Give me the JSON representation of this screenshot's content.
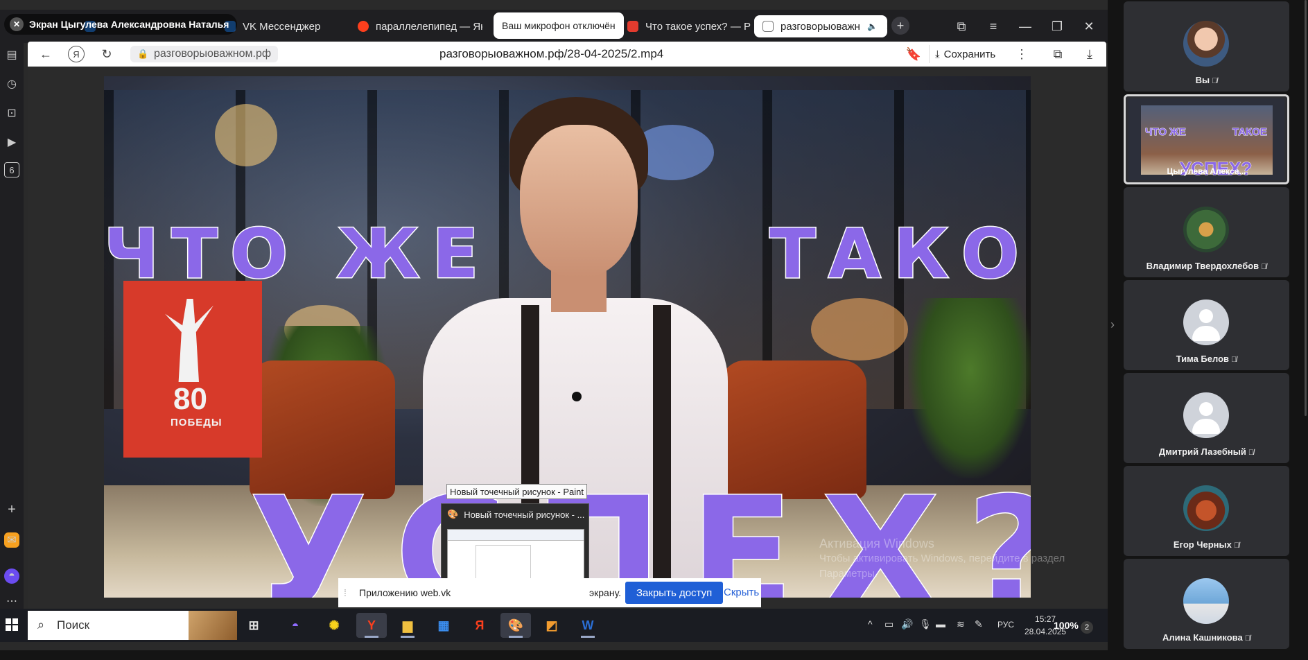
{
  "presenter": {
    "label": "Экран Цыгулева Александровна Наталья"
  },
  "browser": {
    "tabs": [
      {
        "label": "VK Мессенджер",
        "color": "#2787f5"
      },
      {
        "label": "параллелепипед — Янд",
        "color": "#fc3f1d"
      },
      {
        "label": "Что такое успех? — Раз",
        "color": "#e23b2e"
      },
      {
        "label": "разговорыоважн",
        "color": "#777777"
      }
    ],
    "mic_toast": "Ваш микрофон отключён",
    "address_host": "разговорыоважном.рф",
    "page_title": "разговорыоважном.рф/28-04-2025/2.mp4",
    "save_label": "Сохранить",
    "rail_badge": "6"
  },
  "video": {
    "line1_left": "ЧТО ЖЕ",
    "line1_right": "ТАКОЕ",
    "line2": "УСПЕХ?",
    "banner_number": "80",
    "banner_word": "ПОБЕДЫ"
  },
  "activation": {
    "title": "Активация Windows",
    "subtitle": "Чтобы активировать Windows, перейдите в раздел",
    "subtitle2": "Параметры."
  },
  "taskbar_preview": {
    "tooltip": "Новый точечный рисунок - Paint",
    "title": "Новый точечный рисунок - ..."
  },
  "share_notice": {
    "text": "Приложению web.vk",
    "text_tail": "экрану.",
    "stop_label": "Закрыть доступ",
    "hide_label": "Скрыть"
  },
  "taskbar": {
    "search_placeholder": "Поиск",
    "lang": "РУС",
    "time": "15:27",
    "date": "28.04.2025",
    "notifications": "2",
    "zoom": "100%"
  },
  "participants": [
    {
      "name": "Вы"
    },
    {
      "name": "Цыгулева Алекса...",
      "screen": true
    },
    {
      "name": "Владимир Твердохлебов"
    },
    {
      "name": "Тима Белов"
    },
    {
      "name": "Дмитрий Лазебный"
    },
    {
      "name": "Егор Черных"
    },
    {
      "name": "Алина Кашникова"
    }
  ],
  "colors": {
    "accent": "#1f5fd6",
    "title_text": "#8b68e8",
    "banner": "#d73a2a"
  }
}
